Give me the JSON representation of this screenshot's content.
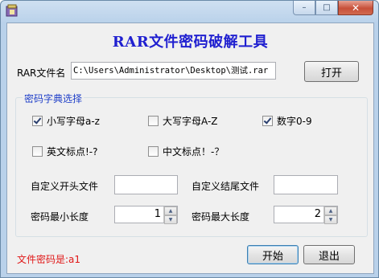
{
  "window": {
    "title": "",
    "caption": {
      "minimize": "–",
      "maximize": "□",
      "close": "✕"
    }
  },
  "heading": "RAR文件密码破解工具",
  "file": {
    "label": "RAR文件名",
    "value": "C:\\Users\\Administrator\\Desktop\\测试.rar",
    "open_button": "打开"
  },
  "charset": {
    "legend": "密码字典选择",
    "options": [
      {
        "label": "小写字母a-z",
        "checked": true
      },
      {
        "label": "大写字母A-Z",
        "checked": false
      },
      {
        "label": "数字0-9",
        "checked": true
      },
      {
        "label": "英文标点!-?",
        "checked": false
      },
      {
        "label": "中文标点！-？",
        "checked": false
      }
    ],
    "prefix_label": "自定义开头文件",
    "prefix_value": "",
    "suffix_label": "自定义结尾文件",
    "suffix_value": "",
    "min_len_label": "密码最小长度",
    "min_len": "1",
    "max_len_label": "密码最大长度",
    "max_len": "2"
  },
  "result_text": "文件密码是:a1",
  "buttons": {
    "start": "开始",
    "exit": "退出"
  }
}
